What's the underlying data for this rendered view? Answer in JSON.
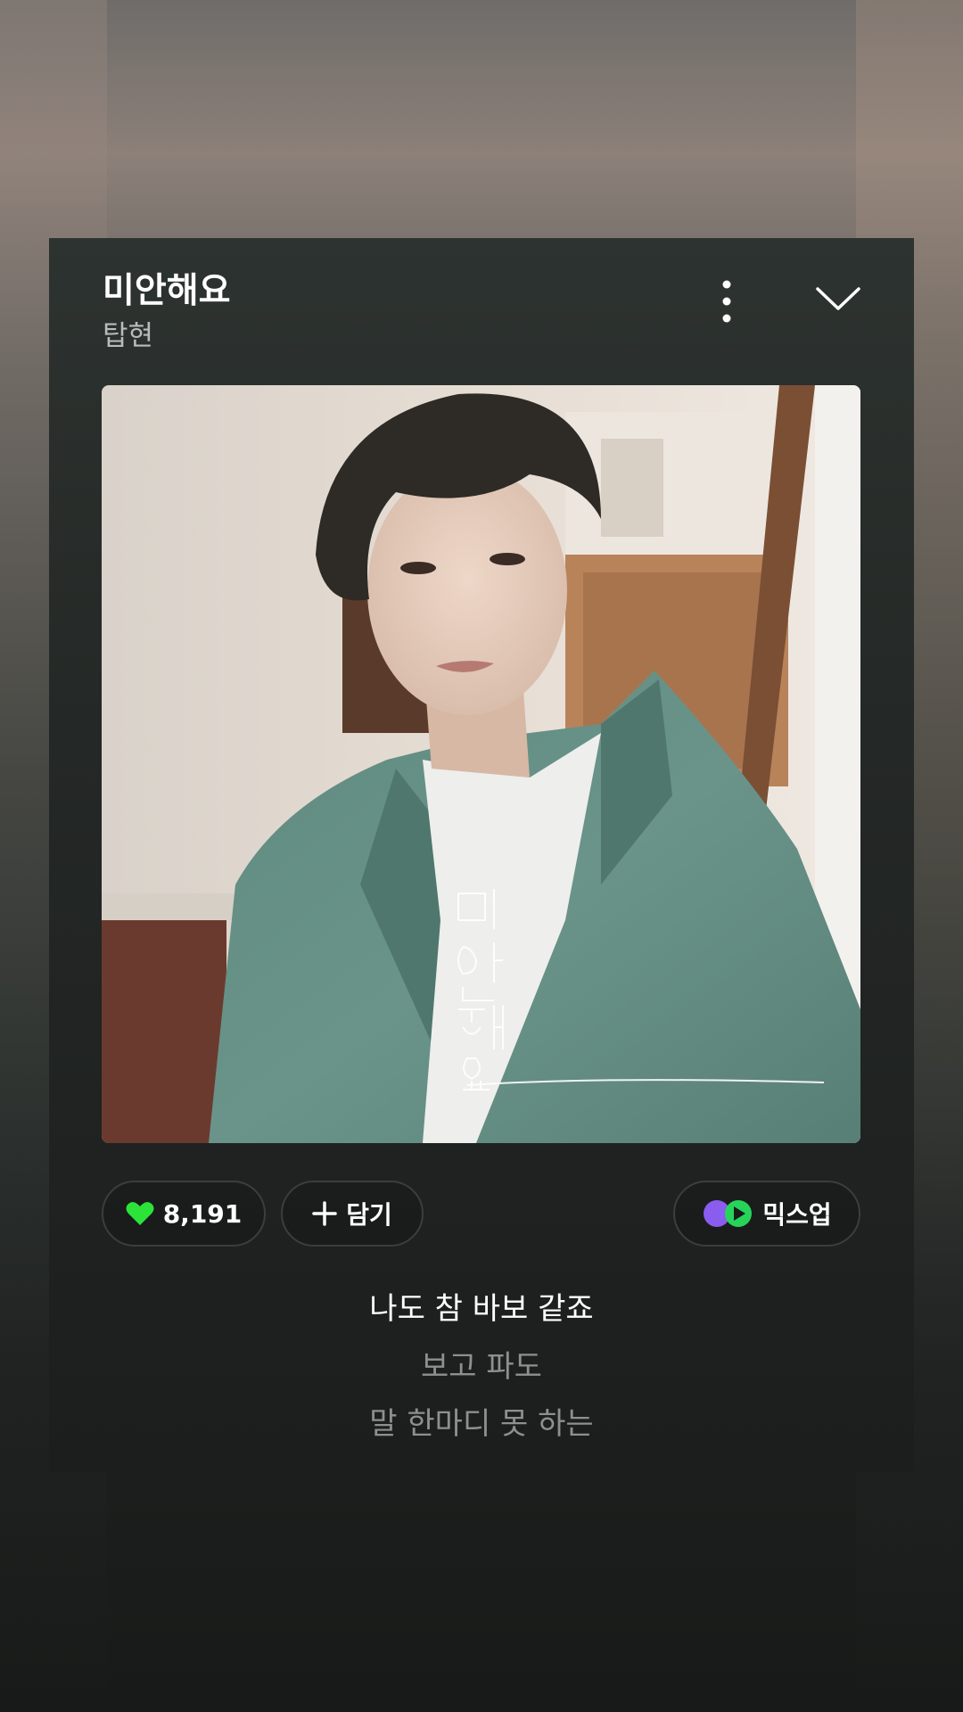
{
  "track": {
    "title": "미안해요",
    "artist": "탑현"
  },
  "album_art": {
    "cover_text": "미안해요"
  },
  "actions": {
    "like_count": "8,191",
    "add_label": "담기",
    "mixup_label": "믹스업"
  },
  "lyrics": {
    "current": "나도 참 바보 같죠",
    "next": "보고 파도",
    "next2": "말 한마디 못 하는"
  },
  "icons": {
    "more": "more-vertical-icon",
    "collapse": "chevron-down-icon",
    "like": "heart-icon",
    "add": "plus-icon",
    "mixup": "mixup-icon"
  },
  "colors": {
    "accent": "#2ce33a",
    "mixup_purple": "#8a5cf0",
    "mixup_green": "#27d45a"
  }
}
